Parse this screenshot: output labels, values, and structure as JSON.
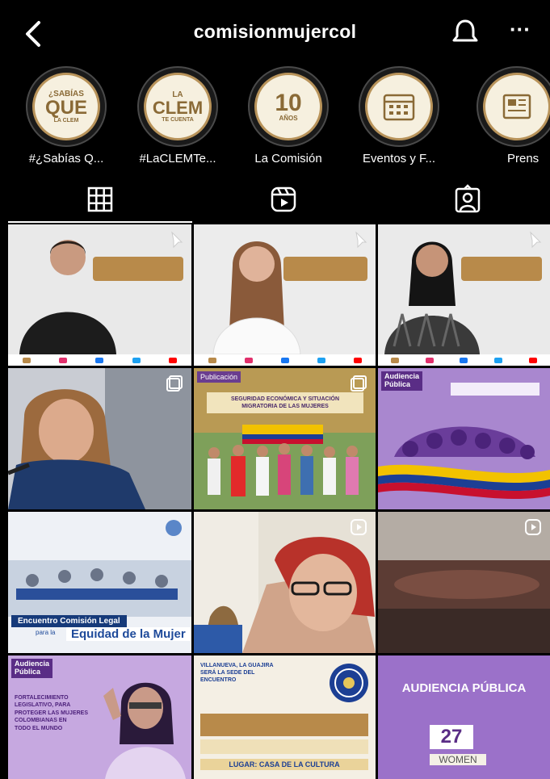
{
  "header": {
    "username": "comisionmujercol",
    "back_icon": "chevron-left-icon",
    "bell_icon": "bell-icon",
    "more_label": "···"
  },
  "highlights": [
    {
      "label": "#¿Sabías Q...",
      "cover_top": "¿SABÍAS",
      "cover_main": "QUE",
      "cover_bottom": "LA CLEM"
    },
    {
      "label": "#LaCLEMTe...",
      "cover_top": "LA",
      "cover_main": "CLEM",
      "cover_bottom": "TE CUENTA"
    },
    {
      "label": "La Comisión",
      "cover_top": "",
      "cover_main": "10",
      "cover_bottom": "AÑOS"
    },
    {
      "label": "Eventos y F...",
      "cover_top": "",
      "cover_main": "",
      "cover_bottom": ""
    },
    {
      "label": "Prens",
      "cover_top": "",
      "cover_main": "",
      "cover_bottom": ""
    }
  ],
  "tabs": [
    {
      "name": "grid-icon"
    },
    {
      "name": "reels-icon"
    },
    {
      "name": "tagged-icon"
    }
  ],
  "posts": {
    "p7_caption_a": "Encuentro Comisión Legal",
    "p7_caption_b": "para la",
    "p7_caption_c": "Equidad de la Mujer",
    "p5_tag": "Publicación",
    "p5_title_a": "SEGURIDAD ECONÓMICA Y SITUACIÓN",
    "p5_title_b": "MIGRATORIA DE LAS MUJERES",
    "p6_tag_a": "Audiencia",
    "p6_tag_b": "Pública",
    "p10_tag_a": "Audiencia",
    "p10_tag_b": "Pública",
    "p10_text_a": "FORTALECIMIENTO",
    "p10_text_b": "LEGISLATIVO, PARA",
    "p10_text_c": "PROTEGER LAS MUJERES",
    "p10_text_d": "COLOMBIANAS EN",
    "p10_text_e": "TODO EL MUNDO",
    "p11_title_a": "VILLANUEVA, LA GUAJIRA",
    "p11_title_b": "SERÁ LA SEDE DEL",
    "p11_title_c": "ENCUENTRO",
    "p11_venue": "LUGAR: CASA DE LA CULTURA",
    "p12_title": "AUDIENCIA PÚBLICA",
    "p12_day": "27",
    "p12_sign": "WOMEN"
  },
  "colors": {
    "gold": "#b88a4a",
    "highlight_bg": "#f6f0df",
    "purple": "#8b5fbf",
    "grid_bg": "#000000"
  }
}
